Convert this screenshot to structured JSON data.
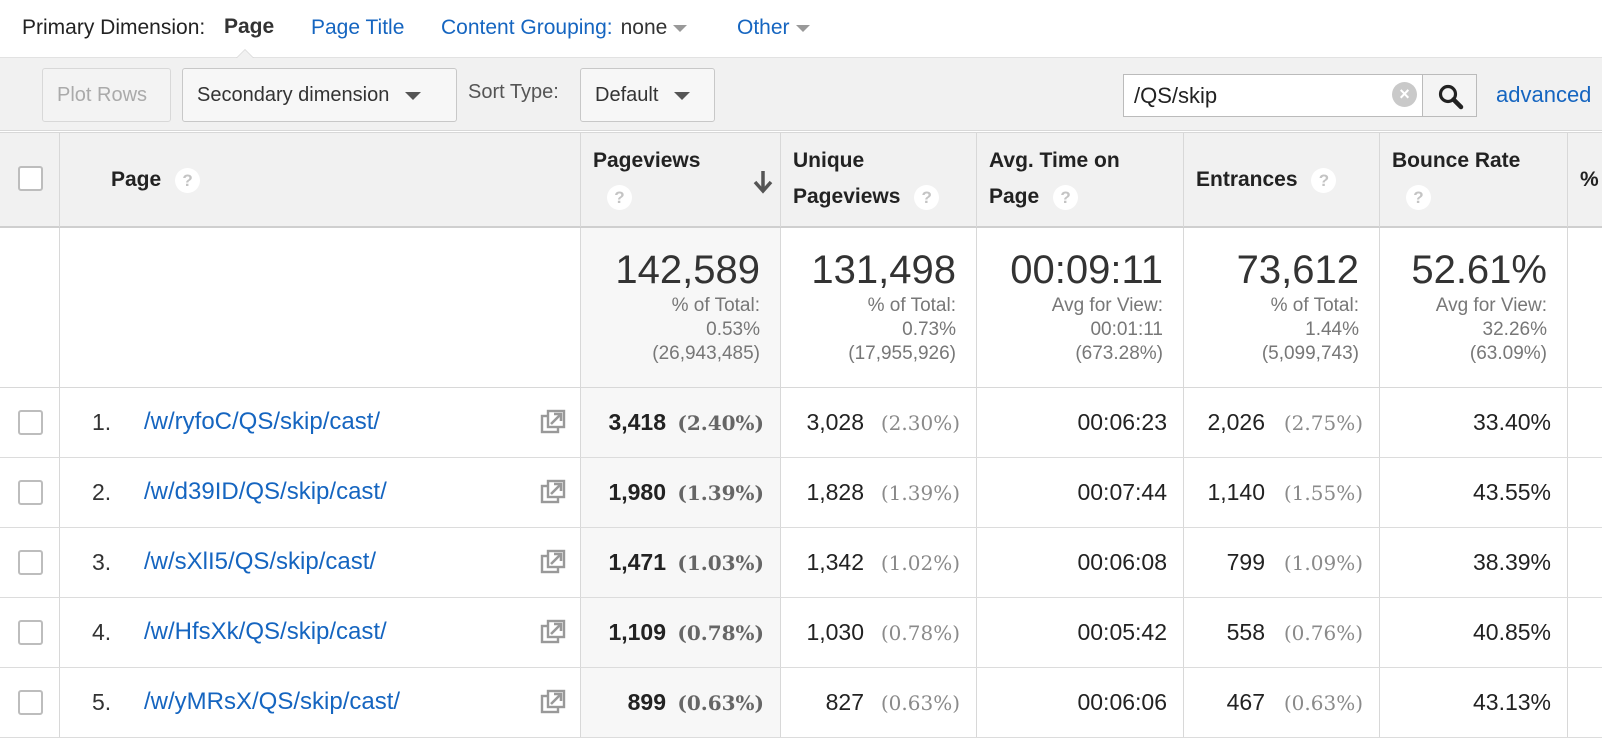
{
  "dimension_bar": {
    "label": "Primary Dimension:",
    "current": "Page",
    "page_title": "Page Title",
    "content_grouping_label": "Content Grouping:",
    "content_grouping_value": "none",
    "other": "Other"
  },
  "toolbar": {
    "plot_rows": "Plot Rows",
    "secondary_dimension": "Secondary dimension",
    "sort_type_label": "Sort Type:",
    "sort_type_value": "Default",
    "search_value": "/QS/skip",
    "advanced": "advanced"
  },
  "table": {
    "headers": {
      "page": "Page",
      "pageviews": "Pageviews",
      "unique_1": "Unique",
      "unique_2": "Pageviews",
      "avg_1": "Avg. Time on",
      "avg_2": "Page",
      "entrances": "Entrances",
      "bounce": "Bounce Rate",
      "pct_exit": "%",
      "help": "?"
    },
    "totals": {
      "pageviews": {
        "value": "142,589",
        "l1": "% of Total:",
        "l2": "0.53%",
        "l3": "(26,943,485)"
      },
      "unique": {
        "value": "131,498",
        "l1": "% of Total:",
        "l2": "0.73%",
        "l3": "(17,955,926)"
      },
      "avg_time": {
        "value": "00:09:11",
        "l1": "Avg for View:",
        "l2": "00:01:11",
        "l3": "(673.28%)"
      },
      "entrances": {
        "value": "73,612",
        "l1": "% of Total:",
        "l2": "1.44%",
        "l3": "(5,099,743)"
      },
      "bounce": {
        "value": "52.61%",
        "l1": "Avg for View:",
        "l2": "32.26%",
        "l3": "(63.09%)"
      }
    },
    "rows": [
      {
        "num": "1.",
        "page": "/w/ryfoC/QS/skip/cast/",
        "pv": "3,418",
        "pv_pct": "(2.40%)",
        "upv": "3,028",
        "upv_pct": "(2.30%)",
        "avg": "00:06:23",
        "ent": "2,026",
        "ent_pct": "(2.75%)",
        "bounce": "33.40%"
      },
      {
        "num": "2.",
        "page": "/w/d39ID/QS/skip/cast/",
        "pv": "1,980",
        "pv_pct": "(1.39%)",
        "upv": "1,828",
        "upv_pct": "(1.39%)",
        "avg": "00:07:44",
        "ent": "1,140",
        "ent_pct": "(1.55%)",
        "bounce": "43.55%"
      },
      {
        "num": "3.",
        "page": "/w/sXlI5/QS/skip/cast/",
        "pv": "1,471",
        "pv_pct": "(1.03%)",
        "upv": "1,342",
        "upv_pct": "(1.02%)",
        "avg": "00:06:08",
        "ent": "799",
        "ent_pct": "(1.09%)",
        "bounce": "38.39%"
      },
      {
        "num": "4.",
        "page": "/w/HfsXk/QS/skip/cast/",
        "pv": "1,109",
        "pv_pct": "(0.78%)",
        "upv": "1,030",
        "upv_pct": "(0.78%)",
        "avg": "00:05:42",
        "ent": "558",
        "ent_pct": "(0.76%)",
        "bounce": "40.85%"
      },
      {
        "num": "5.",
        "page": "/w/yMRsX/QS/skip/cast/",
        "pv": "899",
        "pv_pct": "(0.63%)",
        "upv": "827",
        "upv_pct": "(0.63%)",
        "avg": "00:06:06",
        "ent": "467",
        "ent_pct": "(0.63%)",
        "bounce": "43.13%"
      }
    ]
  },
  "colors": {
    "link": "#1565c0",
    "header_bg": "#f1f1f1"
  },
  "icons": {
    "sort": "arrow-down-icon",
    "search": "magnifier-icon",
    "clear": "clear-icon",
    "external": "external-link-icon",
    "help": "help-icon"
  }
}
